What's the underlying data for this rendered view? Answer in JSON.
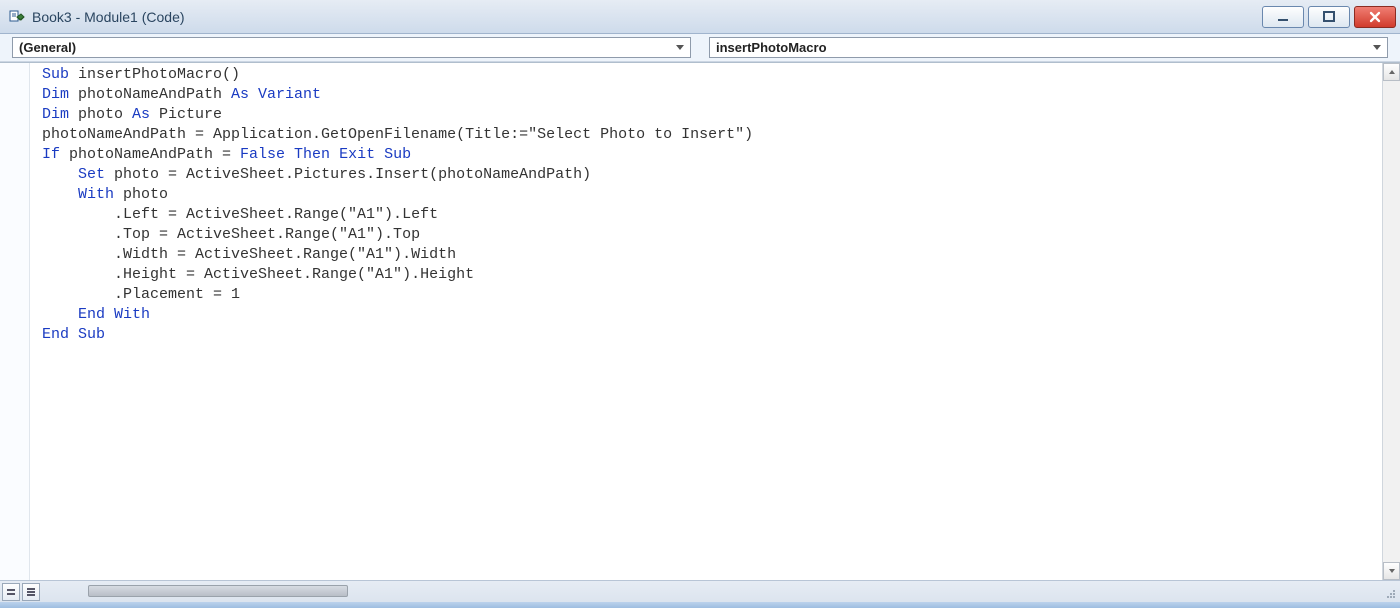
{
  "window": {
    "title": "Book3 - Module1 (Code)"
  },
  "dropdowns": {
    "left": "(General)",
    "right": "insertPhotoMacro"
  },
  "code": {
    "lines": [
      {
        "indent": 0,
        "tokens": [
          {
            "t": "Sub",
            "k": true
          },
          {
            "t": " insertPhotoMacro()",
            "k": false
          }
        ]
      },
      {
        "indent": 0,
        "tokens": [
          {
            "t": "Dim",
            "k": true
          },
          {
            "t": " photoNameAndPath ",
            "k": false
          },
          {
            "t": "As Variant",
            "k": true
          }
        ]
      },
      {
        "indent": 0,
        "tokens": [
          {
            "t": "Dim",
            "k": true
          },
          {
            "t": " photo ",
            "k": false
          },
          {
            "t": "As",
            "k": true
          },
          {
            "t": " Picture",
            "k": false
          }
        ]
      },
      {
        "indent": 0,
        "tokens": [
          {
            "t": "photoNameAndPath = Application.GetOpenFilename(Title:=\"Select Photo to Insert\")",
            "k": false
          }
        ]
      },
      {
        "indent": 0,
        "tokens": [
          {
            "t": "If",
            "k": true
          },
          {
            "t": " photoNameAndPath = ",
            "k": false
          },
          {
            "t": "False Then Exit Sub",
            "k": true
          }
        ]
      },
      {
        "indent": 1,
        "tokens": [
          {
            "t": "Set",
            "k": true
          },
          {
            "t": " photo = ActiveSheet.Pictures.Insert(photoNameAndPath)",
            "k": false
          }
        ]
      },
      {
        "indent": 1,
        "tokens": [
          {
            "t": "With",
            "k": true
          },
          {
            "t": " photo",
            "k": false
          }
        ]
      },
      {
        "indent": 2,
        "tokens": [
          {
            "t": ".Left = ActiveSheet.Range(\"A1\").Left",
            "k": false
          }
        ]
      },
      {
        "indent": 2,
        "tokens": [
          {
            "t": ".Top = ActiveSheet.Range(\"A1\").Top",
            "k": false
          }
        ]
      },
      {
        "indent": 2,
        "tokens": [
          {
            "t": ".Width = ActiveSheet.Range(\"A1\").Width",
            "k": false
          }
        ]
      },
      {
        "indent": 2,
        "tokens": [
          {
            "t": ".Height = ActiveSheet.Range(\"A1\").Height",
            "k": false
          }
        ]
      },
      {
        "indent": 2,
        "tokens": [
          {
            "t": ".Placement = 1",
            "k": false
          }
        ]
      },
      {
        "indent": 0,
        "tokens": [
          {
            "t": "",
            "k": false
          }
        ]
      },
      {
        "indent": 1,
        "tokens": [
          {
            "t": "End With",
            "k": true
          }
        ]
      },
      {
        "indent": 0,
        "tokens": [
          {
            "t": "End Sub",
            "k": true
          }
        ]
      }
    ]
  }
}
